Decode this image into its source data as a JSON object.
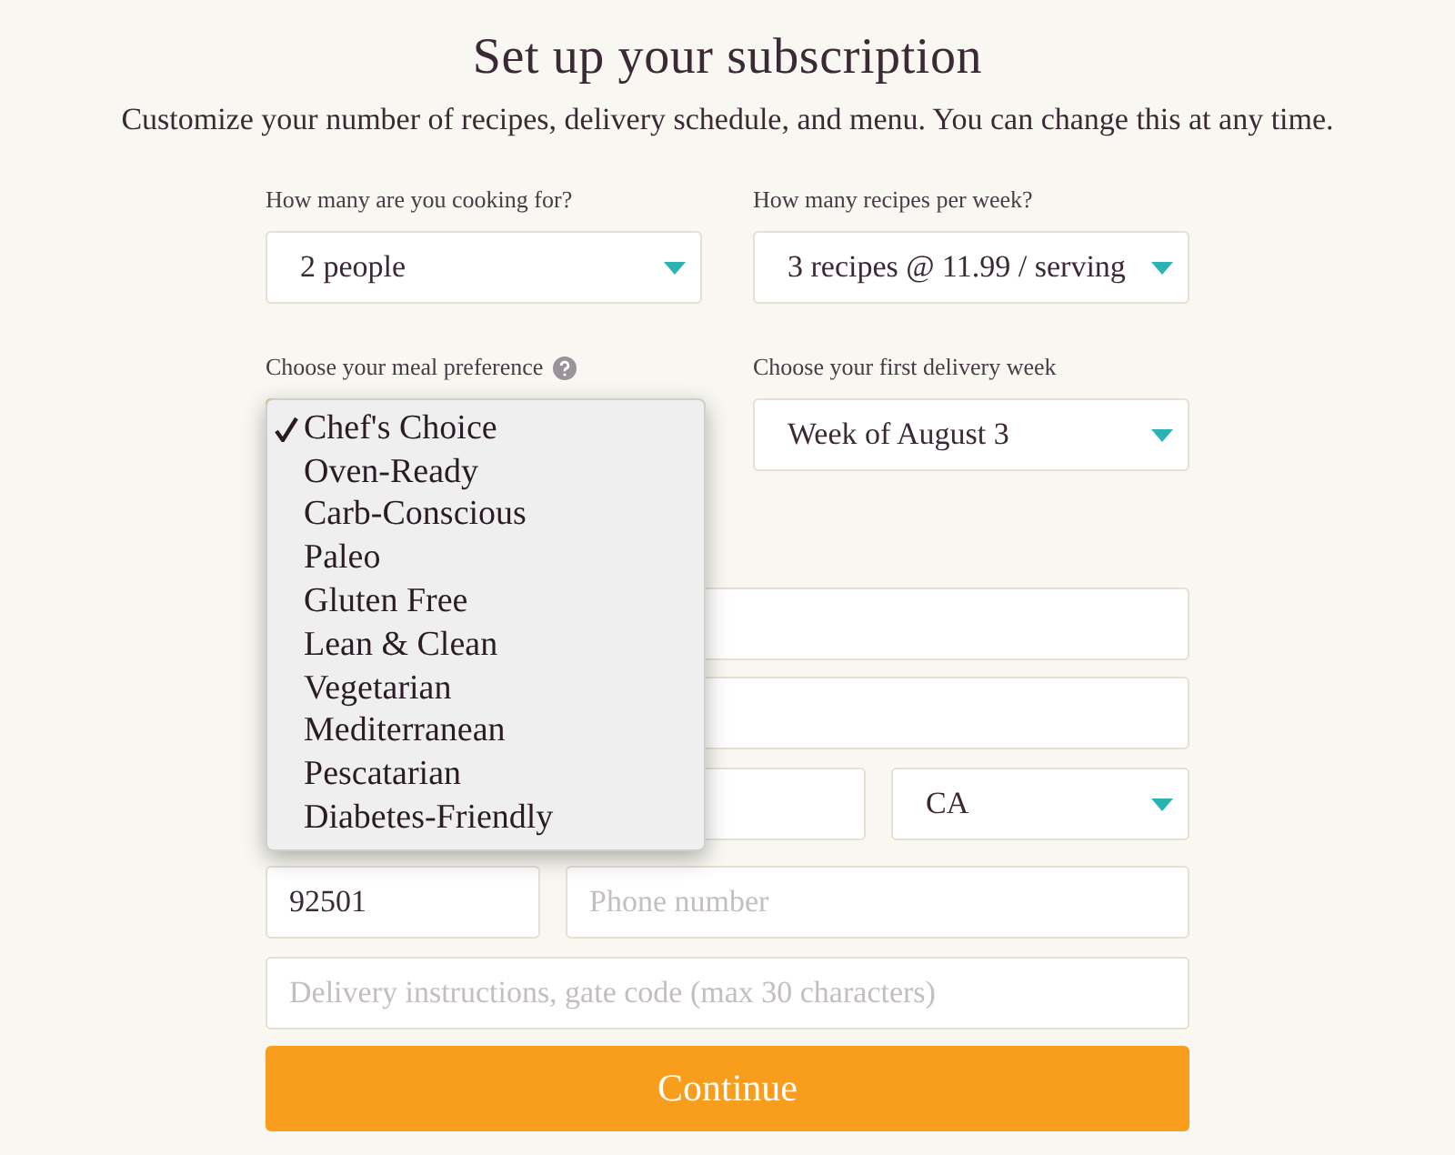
{
  "title": "Set up your subscription",
  "subtitle": "Customize your number of recipes, delivery schedule, and menu. You can change this at any time.",
  "selects": [
    {
      "label": "How many are you cooking for?",
      "value": "2 people"
    },
    {
      "label": "How many recipes per week?",
      "value": "3 recipes @ 11.99 / serving"
    }
  ],
  "meal_preference": {
    "label": "Choose your meal preference",
    "expanded": true,
    "options": [
      {
        "label": "Chef's Choice",
        "selected": true
      },
      {
        "label": "Oven-Ready",
        "selected": false
      },
      {
        "label": "Carb-Conscious",
        "selected": false
      },
      {
        "label": "Paleo",
        "selected": false
      },
      {
        "label": "Gluten Free",
        "selected": false
      },
      {
        "label": "Lean & Clean",
        "selected": false
      },
      {
        "label": "Vegetarian",
        "selected": false
      },
      {
        "label": "Mediterranean",
        "selected": false
      },
      {
        "label": "Pescatarian",
        "selected": false
      },
      {
        "label": "Diabetes-Friendly",
        "selected": false
      }
    ]
  },
  "delivery_week": {
    "label": "Choose your first delivery week",
    "value": "Week of August 3"
  },
  "state": {
    "value": "CA"
  },
  "zip": {
    "value": "92501"
  },
  "phone": {
    "placeholder": "Phone number"
  },
  "instructions": {
    "placeholder": "Delivery instructions, gate code (max 30 characters)"
  },
  "continue_button": "Continue"
}
